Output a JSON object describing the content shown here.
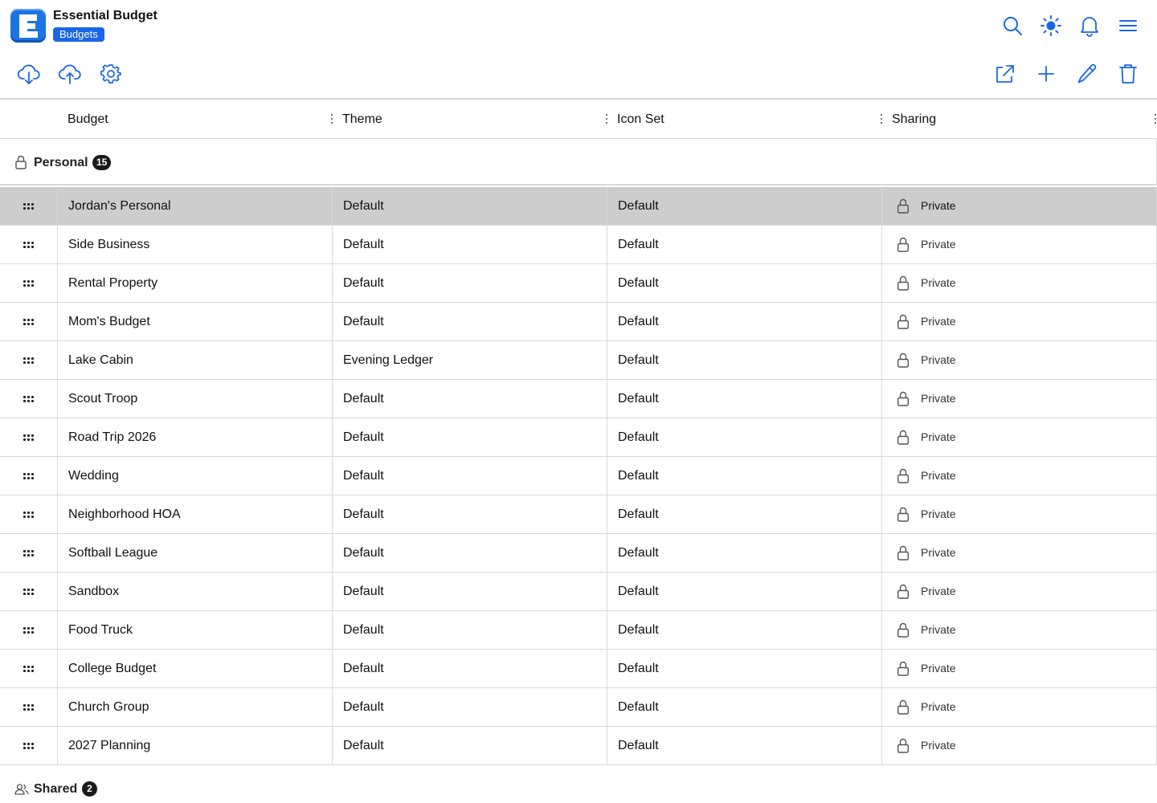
{
  "app": {
    "title": "Essential Budget",
    "section_badge": "Budgets",
    "accent_color": "#1a66e8"
  },
  "header": {
    "icons": [
      "search-icon",
      "sun-icon",
      "bell-icon",
      "menu-icon"
    ],
    "toolbar_left": [
      "cloud-download-icon",
      "cloud-upload-icon",
      "gear-icon"
    ],
    "toolbar_right": [
      "external-link-icon",
      "plus-icon",
      "pencil-icon",
      "trash-icon"
    ]
  },
  "columns": {
    "budget": "Budget",
    "theme": "Theme",
    "icon_set": "Icon Set",
    "sharing": "Sharing"
  },
  "groups": {
    "personal": {
      "label": "Personal",
      "count": "15",
      "icon": "lock-icon"
    },
    "shared": {
      "label": "Shared",
      "count": "2",
      "icon": "users-icon"
    }
  },
  "rows": [
    {
      "name": "Jordan's Personal",
      "theme": "Default",
      "icon_set": "Default",
      "sharing": "Private",
      "selected": true
    },
    {
      "name": "Side Business",
      "theme": "Default",
      "icon_set": "Default",
      "sharing": "Private"
    },
    {
      "name": "Rental Property",
      "theme": "Default",
      "icon_set": "Default",
      "sharing": "Private"
    },
    {
      "name": "Mom's Budget",
      "theme": "Default",
      "icon_set": "Default",
      "sharing": "Private"
    },
    {
      "name": "Lake Cabin",
      "theme": "Evening Ledger",
      "icon_set": "Default",
      "sharing": "Private"
    },
    {
      "name": "Scout Troop",
      "theme": "Default",
      "icon_set": "Default",
      "sharing": "Private"
    },
    {
      "name": "Road Trip 2026",
      "theme": "Default",
      "icon_set": "Default",
      "sharing": "Private"
    },
    {
      "name": "Wedding",
      "theme": "Default",
      "icon_set": "Default",
      "sharing": "Private"
    },
    {
      "name": "Neighborhood HOA",
      "theme": "Default",
      "icon_set": "Default",
      "sharing": "Private"
    },
    {
      "name": "Softball League",
      "theme": "Default",
      "icon_set": "Default",
      "sharing": "Private"
    },
    {
      "name": "Sandbox",
      "theme": "Default",
      "icon_set": "Default",
      "sharing": "Private"
    },
    {
      "name": "Food Truck",
      "theme": "Default",
      "icon_set": "Default",
      "sharing": "Private"
    },
    {
      "name": "College Budget",
      "theme": "Default",
      "icon_set": "Default",
      "sharing": "Private"
    },
    {
      "name": "Church Group",
      "theme": "Default",
      "icon_set": "Default",
      "sharing": "Private"
    },
    {
      "name": "2027 Planning",
      "theme": "Default",
      "icon_set": "Default",
      "sharing": "Private"
    }
  ]
}
